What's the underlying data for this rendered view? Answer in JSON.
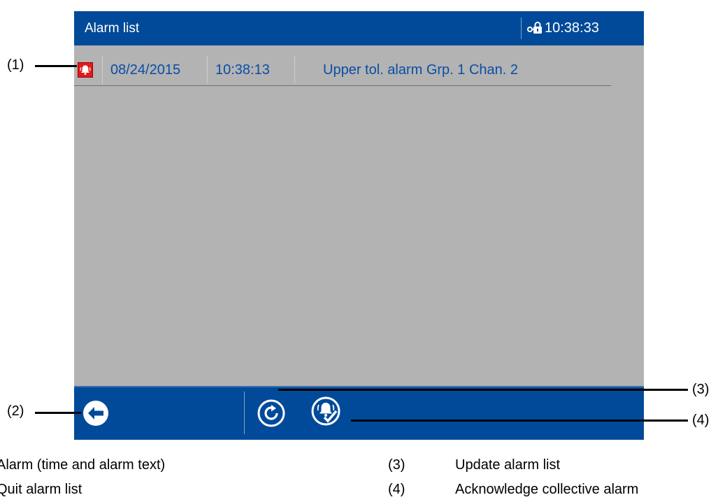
{
  "screen": {
    "title": "Alarm list",
    "clock": "10:38:33",
    "icons": {
      "status": "lock-key-icon",
      "alarm": "alarm-bell-icon"
    }
  },
  "alarms": [
    {
      "date": "08/24/2015",
      "time": "10:38:13",
      "text": "Upper tol. alarm Grp. 1 Chan. 2"
    }
  ],
  "toolbar": {
    "buttons": [
      {
        "icon": "back-arrow-icon",
        "action": "Quit alarm list"
      },
      {
        "icon": "refresh-icon",
        "action": "Update alarm list"
      },
      {
        "icon": "acknowledge-alarm-icon",
        "action": "Acknowledge collective alarm"
      }
    ]
  },
  "callouts": [
    "(1)",
    "(2)",
    "(3)",
    "(4)"
  ],
  "legend": [
    {
      "text": "Alarm (time and alarm text)"
    },
    {
      "text": "Quit alarm list"
    },
    {
      "num": "(3)",
      "text": "Update alarm list"
    },
    {
      "num": "(4)",
      "text": "Acknowledge collective alarm"
    }
  ],
  "colors": {
    "titlebar": "#004a99",
    "screen_background": "#b3b3b3",
    "alarm_text": "#0a4ea6",
    "alarm_icon": "#e01b1b"
  }
}
